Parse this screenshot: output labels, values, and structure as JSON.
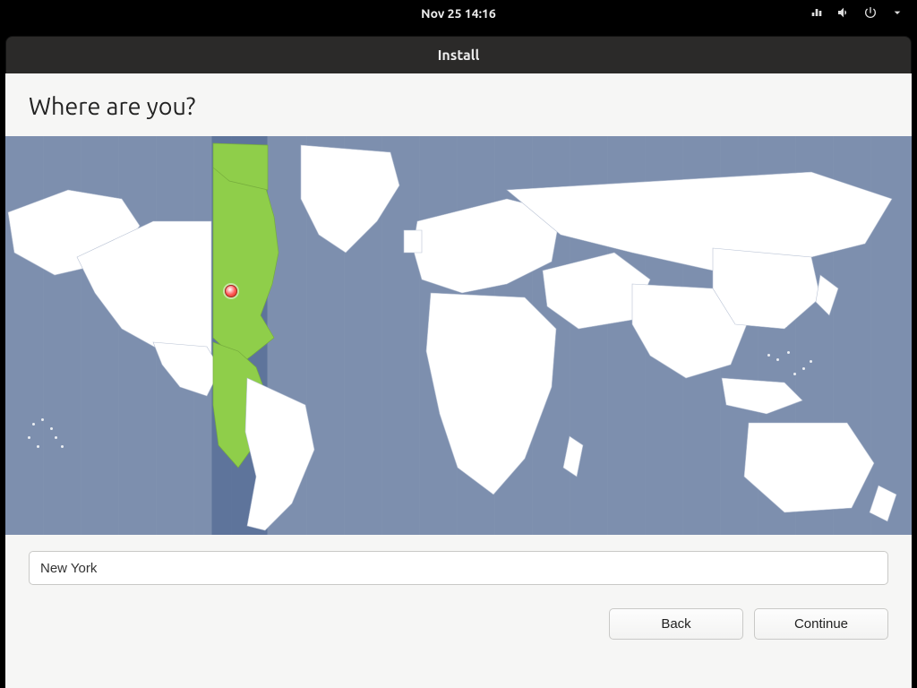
{
  "topbar": {
    "datetime": "Nov 25  14:16"
  },
  "window": {
    "title": "Install"
  },
  "page": {
    "heading": "Where are you?"
  },
  "timezone": {
    "value": "New York"
  },
  "buttons": {
    "back": "Back",
    "continue": "Continue"
  },
  "icons": {
    "network": "network-icon",
    "volume": "volume-icon",
    "power": "power-icon",
    "dropdown": "chevron-down-icon"
  }
}
